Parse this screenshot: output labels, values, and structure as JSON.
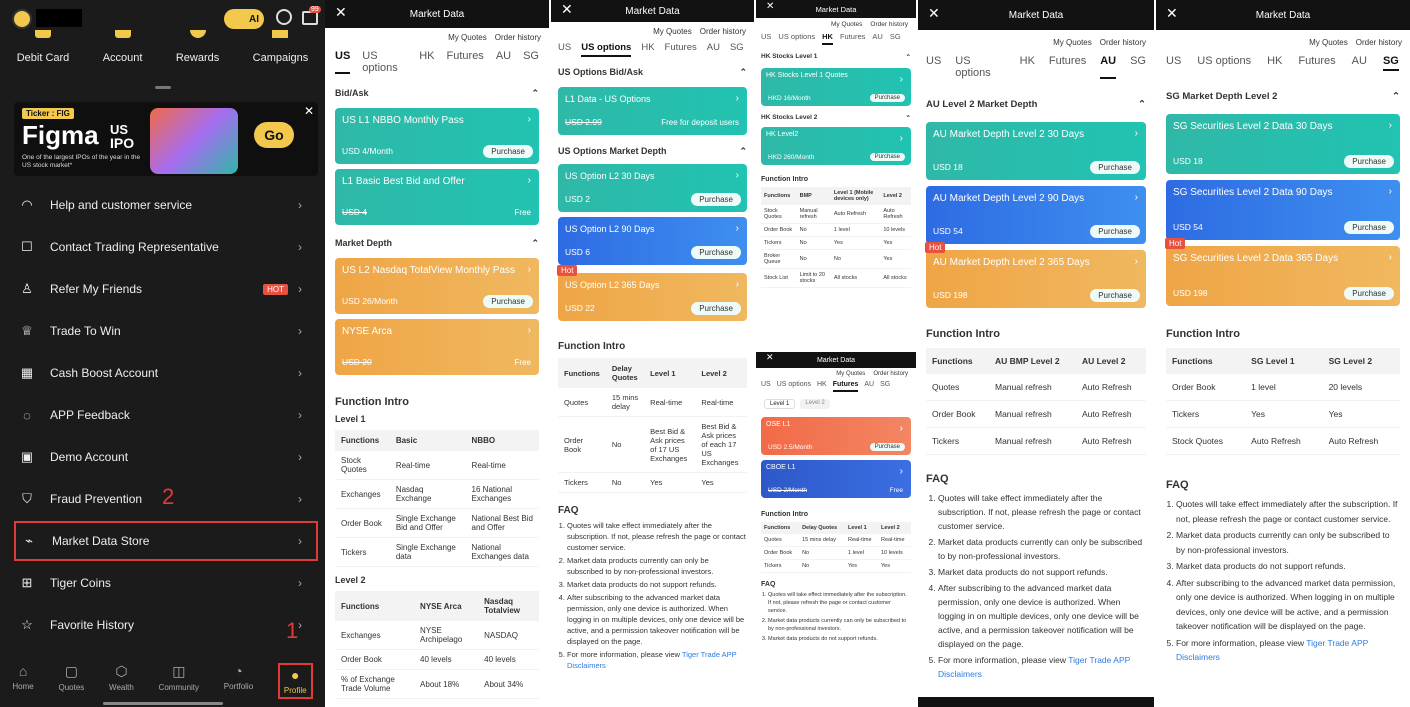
{
  "p1": {
    "shortcuts": [
      "Debit Card",
      "Account",
      "Rewards",
      "Campaigns"
    ],
    "ai_label": "AI",
    "badge_99": "99",
    "banner": {
      "ticker": "Ticker : FIG",
      "brand": "Figma",
      "us": "US",
      "ipo": "IPO",
      "sub": "One of the largest IPOs of the year in the US stock market*",
      "go": "Go"
    },
    "menu": [
      "Help and customer service",
      "Contact Trading Representative",
      "Refer My Friends",
      "Trade To Win",
      "Cash Boost Account",
      "APP Feedback",
      "Demo Account",
      "Fraud Prevention",
      "Market Data Store",
      "Tiger Coins",
      "Favorite History"
    ],
    "hot": "HOT",
    "step1": "1",
    "step2": "2",
    "nav": [
      "Home",
      "Quotes",
      "Wealth",
      "Community",
      "Portfolio",
      "Profile"
    ]
  },
  "common": {
    "title": "Market Data",
    "my_quotes": "My Quotes",
    "order_history": "Order history",
    "tabs": [
      "US",
      "US options",
      "HK",
      "Futures",
      "AU",
      "SG"
    ],
    "purchase": "Purchase",
    "free": "Free",
    "hot": "Hot",
    "function_intro": "Function Intro",
    "faq": "FAQ"
  },
  "p2": {
    "bidask": "Bid/Ask",
    "c1": {
      "t": "US L1 NBBO Monthly Pass",
      "p": "USD 4/Month"
    },
    "c2": {
      "t": "L1 Basic Best Bid and Offer",
      "p": "USD 4"
    },
    "depth": "Market Depth",
    "c3": {
      "t": "US L2 Nasdaq TotalView Monthly Pass",
      "p": "USD 26/Month"
    },
    "c4": {
      "t": "NYSE Arca",
      "p": "USD 20"
    },
    "level1": "Level 1",
    "t1h": [
      "Functions",
      "Basic",
      "NBBO"
    ],
    "t1": [
      [
        "Stock Quotes",
        "Real-time",
        "Real-time"
      ],
      [
        "Exchanges",
        "Nasdaq Exchange",
        "16 National Exchanges"
      ],
      [
        "Order Book",
        "Single Exchange Bid and Offer",
        "National Best Bid and Offer"
      ],
      [
        "Tickers",
        "Single Exchange data",
        "National Exchanges data"
      ]
    ],
    "level2": "Level 2",
    "t2h": [
      "Functions",
      "NYSE Arca",
      "Nasdaq Totalview"
    ],
    "t2": [
      [
        "Exchanges",
        "NYSE Archipelago",
        "NASDAQ"
      ],
      [
        "Order Book",
        "40 levels",
        "40 levels"
      ],
      [
        "% of Exchange Trade Volume",
        "About 18%",
        "About 34%"
      ]
    ]
  },
  "p3": {
    "s1": "US Options Bid/Ask",
    "c1": {
      "t": "L1 Data - US Options",
      "p": "USD 2.99",
      "r": "Free for deposit users"
    },
    "s2": "US Options Market Depth",
    "c2": {
      "t": "US Option L2 30 Days",
      "p": "USD 2"
    },
    "c3": {
      "t": "US Option L2 90 Days",
      "p": "USD 6"
    },
    "c4": {
      "t": "US Option L2 365 Days",
      "p": "USD 22"
    },
    "th": [
      "Functions",
      "Delay Quotes",
      "Level 1",
      "Level 2"
    ],
    "rows": [
      [
        "Quotes",
        "15 mins delay",
        "Real-time",
        "Real-time"
      ],
      [
        "Order Book",
        "No",
        "Best Bid & Ask prices of 17 US Exchanges",
        "Best Bid & Ask prices of each 17 US Exchanges"
      ],
      [
        "Tickers",
        "No",
        "Yes",
        "Yes"
      ]
    ],
    "faq": [
      "Quotes will take effect immediately after the subscription. If not, please refresh the page or contact customer service.",
      "Market data products currently can only be subscribed to by non-professional investors.",
      "Market data products do not support refunds.",
      "After subscribing to the advanced market data permission, only one device is authorized. When logging in on multiple devices, only one device will be active, and a permission takeover notification will be displayed on the page."
    ],
    "faq5": "For more information, please view ",
    "faq5_link": "Tiger Trade APP Disclaimers"
  },
  "p4": {
    "s1": "HK Stocks Level 1",
    "c1": {
      "t": "HK Stocks Level 1 Quotes",
      "p": "HKD 16/Month"
    },
    "s2": "HK Stocks Level 2",
    "c2": {
      "t": "HK Level2",
      "p": "HKD 260/Month"
    },
    "th": [
      "Functions",
      "BMP",
      "Level 1 (Mobile devices only)",
      "Level 2"
    ],
    "rows": [
      [
        "Stock Quotes",
        "Manual refresh",
        "Auto Refresh",
        "Auto Refresh"
      ],
      [
        "Order Book",
        "No",
        "1 level",
        "10 levels"
      ],
      [
        "Tickers",
        "No",
        "Yes",
        "Yes"
      ],
      [
        "Broker Queue",
        "No",
        "No",
        "Yes"
      ],
      [
        "Stock List",
        "Limit to 20 stocks",
        "All stocks",
        "All stocks"
      ]
    ],
    "subtabs": [
      "Level 1",
      "Level 2"
    ],
    "c3": {
      "t": "OSE L1",
      "p": "USD 2.5/Month"
    },
    "c4": {
      "t": "CBOE L1",
      "p": "USD 2/Month"
    },
    "th2": [
      "Functions",
      "Delay Quotes",
      "Level 1",
      "Level 2"
    ],
    "rows2": [
      [
        "Quotes",
        "15 mins delay",
        "Real-time",
        "Real-time"
      ],
      [
        "Order Book",
        "No",
        "1 level",
        "10 levels"
      ],
      [
        "Tickers",
        "No",
        "Yes",
        "Yes"
      ]
    ],
    "faq": [
      "Quotes will take effect immediately after the subscription. If not, please refresh the page or contact customer service.",
      "Market data products currently can only be subscribed to by non-professional investors.",
      "Market data products do not support refunds."
    ]
  },
  "p5": {
    "s1": "AU Level 2 Market Depth",
    "c1": {
      "t": "AU Market Depth Level 2 30 Days",
      "p": "USD 18"
    },
    "c2": {
      "t": "AU Market Depth Level 2 90 Days",
      "p": "USD 54"
    },
    "c3": {
      "t": "AU Market Depth Level 2 365 Days",
      "p": "USD 198"
    },
    "th": [
      "Functions",
      "AU BMP Level 2",
      "AU Level 2"
    ],
    "rows": [
      [
        "Quotes",
        "Manual refresh",
        "Auto Refresh"
      ],
      [
        "Order Book",
        "Manual refresh",
        "Auto Refresh"
      ],
      [
        "Tickers",
        "Manual refresh",
        "Auto Refresh"
      ]
    ]
  },
  "p6": {
    "s1": "SG Market Depth Level 2",
    "c1": {
      "t": "SG Securities Level 2 Data 30 Days",
      "p": "USD 18"
    },
    "c2": {
      "t": "SG Securities Level 2 Data 90 Days",
      "p": "USD 54"
    },
    "c3": {
      "t": "SG Securities Level 2 Data 365 Days",
      "p": "USD 198"
    },
    "th": [
      "Functions",
      "SG Level 1",
      "SG Level 2"
    ],
    "rows": [
      [
        "Order Book",
        "1 level",
        "20 levels"
      ],
      [
        "Tickers",
        "Yes",
        "Yes"
      ],
      [
        "Stock Quotes",
        "Auto Refresh",
        "Auto Refresh"
      ]
    ]
  },
  "colors": {
    "teal": "#2fb8a7",
    "blue": "#2e6be3",
    "orange": "#efa546",
    "red_step": "#e03a3a",
    "hot": "#e8503f",
    "link": "#2d7be3"
  }
}
